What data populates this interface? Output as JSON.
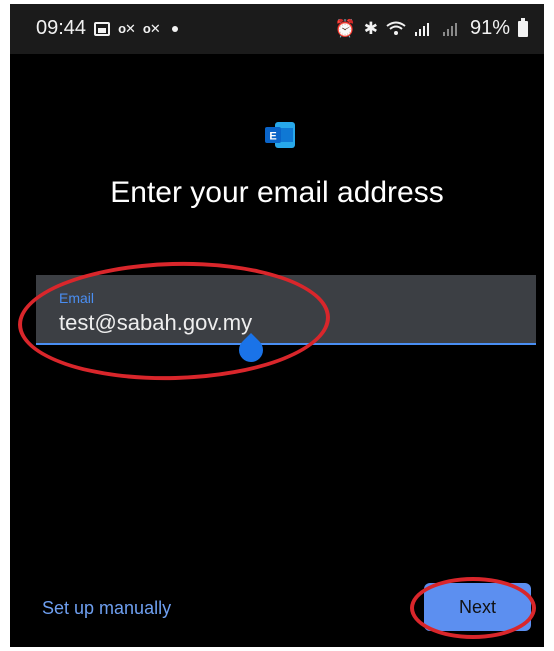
{
  "status_bar": {
    "time": "09:44",
    "notification_glyphs": [
      "o✕",
      "o✕"
    ],
    "battery_percent": "91%",
    "icons": [
      "image-icon",
      "alarm-icon",
      "bluetooth-icon",
      "wifi-icon",
      "signal-icon",
      "battery-icon"
    ]
  },
  "app": {
    "logo": "exchange-logo-icon"
  },
  "screen": {
    "title": "Enter your email address",
    "email_field": {
      "label": "Email",
      "value": "test@sabah.gov.my"
    }
  },
  "footer": {
    "manual_setup_label": "Set up manually",
    "next_label": "Next"
  },
  "colors": {
    "accent": "#4a8ef2",
    "button": "#5c8ff0",
    "annotation": "#d9262b"
  }
}
